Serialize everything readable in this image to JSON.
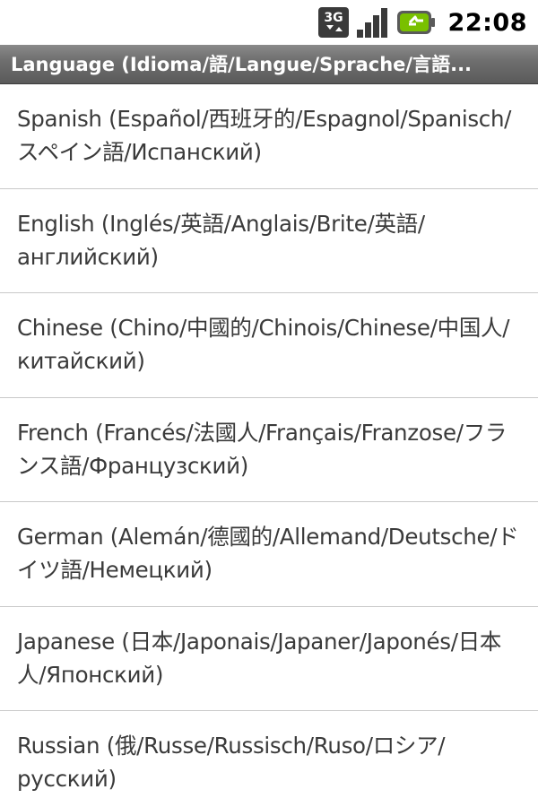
{
  "status_bar": {
    "network_type": "3G",
    "time": "22:08",
    "icons": [
      "3g-data-icon",
      "signal-strength-icon",
      "battery-charging-icon"
    ]
  },
  "title_bar": {
    "title": "Language (Idioma/語/Langue/Sprache/言語..."
  },
  "languages": [
    {
      "label": "Spanish (Español/西班牙的/Espagnol/Spanisch/スペイン語/Испанский)"
    },
    {
      "label": "English (Inglés/英語/Anglais/Brite/英語/английский)"
    },
    {
      "label": "Chinese (Chino/中國的/Chinois/Chinese/中国人/китайский)"
    },
    {
      "label": "French (Francés/法國人/Français/Franzose/フランス語/Французский)"
    },
    {
      "label": "German (Alemán/德國的/Allemand/Deutsche/ドイツ語/Немецкий)"
    },
    {
      "label": "Japanese (日本/Japonais/Japaner/Japonés/日本人/Японский)"
    },
    {
      "label": "Russian (俄/Russe/Russisch/Ruso/ロシア/русский)"
    }
  ],
  "colors": {
    "title_bar_bg": "#6f6f6f",
    "list_text": "#3a3a3a",
    "divider": "#c9c9c9",
    "battery_green": "#79c000"
  }
}
